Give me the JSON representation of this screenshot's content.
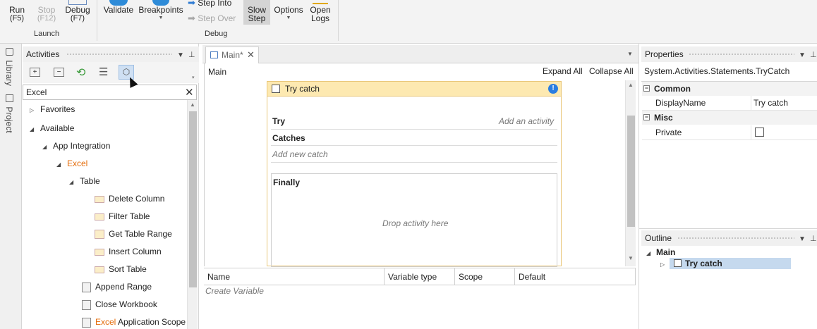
{
  "ribbon": {
    "run": "Run",
    "run_key": "(F5)",
    "stop": "Stop",
    "stop_key": "(F12)",
    "debug": "Debug",
    "debug_key": "(F7)",
    "launch_group": "Launch",
    "validate": "Validate",
    "breakpoints": "Breakpoints",
    "step_into": "Step Into",
    "step_over": "Step Over",
    "slow_step_1": "Slow",
    "slow_step_2": "Step",
    "options": "Options",
    "open_logs_1": "Open",
    "open_logs_2": "Logs",
    "debug_group": "Debug"
  },
  "sidetabs": {
    "library": "Library",
    "project": "Project"
  },
  "activities": {
    "title": "Activities",
    "search_value": "Excel",
    "tree": {
      "favorites": "Favorites",
      "available": "Available",
      "app_integration": "App Integration",
      "excel": "Excel",
      "table": "Table",
      "delete_column": "Delete Column",
      "filter_table": "Filter Table",
      "get_table_range": "Get Table Range",
      "insert_column": "Insert Column",
      "sort_table": "Sort Table",
      "append_range": "Append Range",
      "close_workbook": "Close Workbook",
      "excel_app_scope_1": "Excel",
      "excel_app_scope_2": " Application Scope"
    }
  },
  "designer": {
    "tab": "Main*",
    "breadcrumb": "Main",
    "expand_all": "Expand All",
    "collapse_all": "Collapse All",
    "trycatch": {
      "title": "Try catch",
      "try": "Try",
      "add_activity": "Add an activity",
      "catches": "Catches",
      "add_catch": "Add new catch",
      "finally": "Finally",
      "drop_here": "Drop activity here"
    }
  },
  "variables": {
    "columns": [
      "Name",
      "Variable type",
      "Scope",
      "Default"
    ],
    "create": "Create Variable"
  },
  "properties": {
    "title": "Properties",
    "type_name": "System.Activities.Statements.TryCatch",
    "cat_common": "Common",
    "display_name_label": "DisplayName",
    "display_name_value": "Try catch",
    "cat_misc": "Misc",
    "private_label": "Private"
  },
  "outline": {
    "title": "Outline",
    "main": "Main",
    "try_catch": "Try catch"
  },
  "colors": {
    "accent_orange": "#e46c0a",
    "trycatch_header": "#fde9b1",
    "selection": "#c5d9ee"
  }
}
